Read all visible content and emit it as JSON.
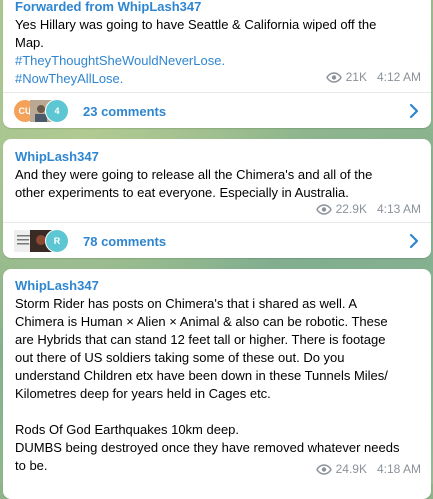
{
  "posts": [
    {
      "forwarded": "Forwarded from WhipLash347",
      "lines": [
        "Yes Hillary was going to have Seattle & California wiped off the",
        "Map."
      ],
      "tags": [
        "#TheyThoughtSheWouldNeverLose.",
        "#NowTheyAllLose."
      ],
      "views": "21K",
      "time": "4:12 AM",
      "comments": "23 comments",
      "avatars": [
        "CU",
        "",
        "4"
      ]
    },
    {
      "author": "WhipLash347",
      "lines": [
        "And they were going to release all the Chimera's and all of the",
        "other experiments to eat everyone. Especially in Australia."
      ],
      "views": "22.9K",
      "time": "4:13 AM",
      "comments": "78 comments",
      "avatars": [
        "",
        "",
        "R"
      ]
    },
    {
      "author": "WhipLash347",
      "lines": [
        "Storm Rider has posts on Chimera's that i shared as well. A",
        "Chimera is Human × Alien × Animal & also can be robotic. These",
        "are Hybrids that can stand 12 feet tall or higher. There is footage",
        "out there of US soldiers taking some of these out. Do you",
        "understand Children etx have been down in these Tunnels Miles/",
        "Kilometres deep for years held in Cages etc.",
        "",
        "Rods Of God Earthquakes 10km deep.",
        "DUMBS being destroyed once they have removed whatever needs",
        "to be."
      ],
      "views": "24.9K",
      "time": "4:18 AM"
    }
  ],
  "colors": {
    "accent": "#2f86d0",
    "meta": "#8b9299",
    "avatar_cu": "#f4a25a",
    "avatar_4": "#5cc7d2",
    "avatar_r": "#5cc7d2"
  },
  "icons": {
    "views": "eye-icon",
    "open": "chevron-right-icon"
  }
}
